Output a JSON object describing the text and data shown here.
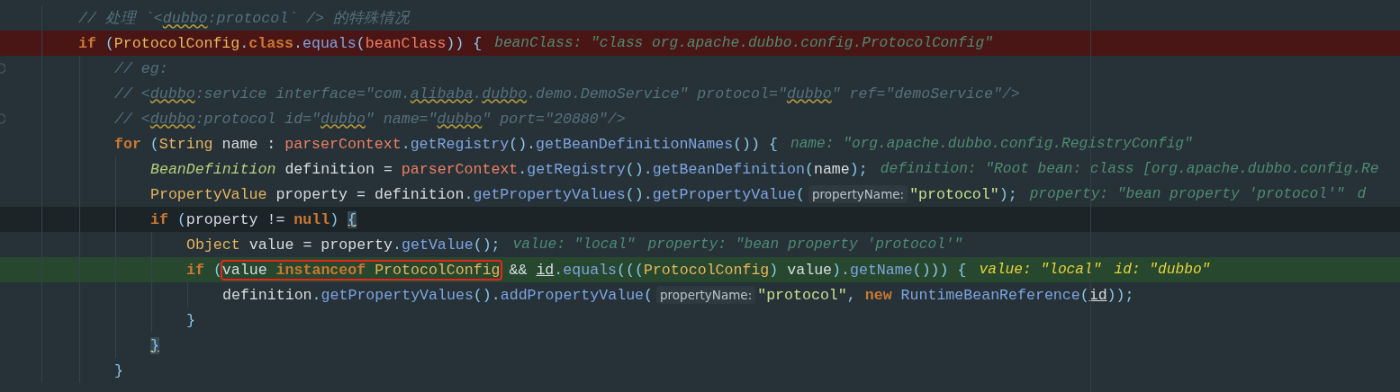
{
  "lines": [
    {
      "kind": "plain",
      "fold": false,
      "parts": [
        {
          "kind": "code",
          "tokens": [
            {
              "t": "// 处理 `<",
              "kind": "comment"
            },
            {
              "t": "dubbo",
              "kind": "typo"
            },
            {
              "t": ":protocol` /> 的特殊情况",
              "kind": "comment"
            }
          ]
        }
      ]
    },
    {
      "kind": "breakpoint",
      "fold": false,
      "parts": [
        {
          "kind": "code",
          "tokens": [
            {
              "t": "if",
              "kind": "kw"
            },
            {
              "t": " (",
              "kind": "punc"
            },
            {
              "t": "ProtocolConfig",
              "kind": "cls"
            },
            {
              "t": ".",
              "kind": "punc"
            },
            {
              "t": "class",
              "kind": "kw"
            },
            {
              "t": ".",
              "kind": "punc"
            },
            {
              "t": "equals",
              "kind": "meth"
            },
            {
              "t": "(",
              "kind": "punc"
            },
            {
              "t": "beanClass",
              "kind": "fld"
            },
            {
              "t": ")) {",
              "kind": "punc"
            }
          ]
        },
        {
          "kind": "hint",
          "text": "beanClass: \"class org.apache.dubbo.config.ProtocolConfig\""
        }
      ],
      "children": [
        {
          "kind": "plain",
          "fold": true,
          "parts": [
            {
              "kind": "code",
              "tokens": [
                {
                  "t": "// eg:",
                  "kind": "comment"
                }
              ]
            }
          ]
        },
        {
          "kind": "plain",
          "fold": false,
          "parts": [
            {
              "kind": "code",
              "tokens": [
                {
                  "t": "// <",
                  "kind": "comment"
                },
                {
                  "t": "dubbo",
                  "kind": "typo"
                },
                {
                  "t": ":service interface=\"com.",
                  "kind": "comment"
                },
                {
                  "t": "alibaba",
                  "kind": "typo"
                },
                {
                  "t": ".",
                  "kind": "comment"
                },
                {
                  "t": "dubbo",
                  "kind": "typo"
                },
                {
                  "t": ".demo.DemoService\" protocol=\"",
                  "kind": "comment"
                },
                {
                  "t": "dubbo",
                  "kind": "typo"
                },
                {
                  "t": "\" ref=\"demoService\"/>",
                  "kind": "comment"
                }
              ]
            }
          ]
        },
        {
          "kind": "plain",
          "fold": true,
          "parts": [
            {
              "kind": "code",
              "tokens": [
                {
                  "t": "// <",
                  "kind": "comment"
                },
                {
                  "t": "dubbo",
                  "kind": "typo"
                },
                {
                  "t": ":protocol id=\"",
                  "kind": "comment"
                },
                {
                  "t": "dubbo",
                  "kind": "typo"
                },
                {
                  "t": "\" name=\"",
                  "kind": "comment"
                },
                {
                  "t": "dubbo",
                  "kind": "typo"
                },
                {
                  "t": "\" port=\"20880\"/>",
                  "kind": "comment"
                }
              ]
            }
          ]
        },
        {
          "kind": "plain",
          "fold": false,
          "parts": [
            {
              "kind": "code",
              "tokens": [
                {
                  "t": "for",
                  "kind": "kw"
                },
                {
                  "t": " (",
                  "kind": "punc"
                },
                {
                  "t": "String",
                  "kind": "cls"
                },
                {
                  "t": " name : ",
                  "kind": "ident"
                },
                {
                  "t": "parserContext",
                  "kind": "fld"
                },
                {
                  "t": ".",
                  "kind": "punc"
                },
                {
                  "t": "getRegistry",
                  "kind": "meth"
                },
                {
                  "t": "().",
                  "kind": "punc"
                },
                {
                  "t": "getBeanDefinitionNames",
                  "kind": "meth"
                },
                {
                  "t": "()) {",
                  "kind": "punc"
                }
              ]
            },
            {
              "kind": "hint",
              "text": "name: \"org.apache.dubbo.config.RegistryConfig\""
            }
          ],
          "children": [
            {
              "kind": "plain",
              "fold": false,
              "parts": [
                {
                  "kind": "code",
                  "tokens": [
                    {
                      "t": "BeanDefinition",
                      "kind": "itype"
                    },
                    {
                      "t": " definition = ",
                      "kind": "ident"
                    },
                    {
                      "t": "parserContext",
                      "kind": "fld"
                    },
                    {
                      "t": ".",
                      "kind": "punc"
                    },
                    {
                      "t": "getRegistry",
                      "kind": "meth"
                    },
                    {
                      "t": "().",
                      "kind": "punc"
                    },
                    {
                      "t": "getBeanDefinition",
                      "kind": "meth"
                    },
                    {
                      "t": "(",
                      "kind": "punc"
                    },
                    {
                      "t": "name",
                      "kind": "ident"
                    },
                    {
                      "t": ");",
                      "kind": "punc"
                    }
                  ]
                },
                {
                  "kind": "hint",
                  "text": "definition: \"Root bean: class [org.apache.dubbo.config.Re"
                }
              ]
            },
            {
              "kind": "plain",
              "fold": false,
              "parts": [
                {
                  "kind": "code",
                  "tokens": [
                    {
                      "t": "PropertyValue",
                      "kind": "cls"
                    },
                    {
                      "t": " property = definition",
                      "kind": "ident"
                    },
                    {
                      "t": ".",
                      "kind": "punc"
                    },
                    {
                      "t": "getPropertyValues",
                      "kind": "meth"
                    },
                    {
                      "t": "().",
                      "kind": "punc"
                    },
                    {
                      "t": "getPropertyValue",
                      "kind": "meth"
                    },
                    {
                      "t": "(",
                      "kind": "punc"
                    }
                  ]
                },
                {
                  "kind": "chip",
                  "text": "propertyName:"
                },
                {
                  "kind": "code",
                  "tokens": [
                    {
                      "t": "\"protocol\"",
                      "kind": "str"
                    },
                    {
                      "t": ");",
                      "kind": "punc"
                    }
                  ]
                },
                {
                  "kind": "hint",
                  "text": "property: \"bean property 'protocol'\""
                },
                {
                  "kind": "hint",
                  "text": "d"
                }
              ]
            },
            {
              "kind": "caret",
              "fold": false,
              "parts": [
                {
                  "kind": "code",
                  "tokens": [
                    {
                      "t": "if",
                      "kind": "kw"
                    },
                    {
                      "t": " (",
                      "kind": "punc"
                    },
                    {
                      "t": "property != ",
                      "kind": "ident"
                    },
                    {
                      "t": "null",
                      "kind": "kw"
                    },
                    {
                      "t": ") ",
                      "kind": "punc"
                    },
                    {
                      "t": "{",
                      "kind": "brace"
                    }
                  ]
                }
              ],
              "children": [
                {
                  "kind": "plain",
                  "fold": false,
                  "parts": [
                    {
                      "kind": "code",
                      "tokens": [
                        {
                          "t": "Object",
                          "kind": "cls"
                        },
                        {
                          "t": " value = property",
                          "kind": "ident"
                        },
                        {
                          "t": ".",
                          "kind": "punc"
                        },
                        {
                          "t": "getValue",
                          "kind": "meth"
                        },
                        {
                          "t": "();",
                          "kind": "punc"
                        }
                      ]
                    },
                    {
                      "kind": "hint",
                      "text": "value: \"local\""
                    },
                    {
                      "kind": "hint",
                      "text": "property: \"bean property 'protocol'\""
                    }
                  ]
                },
                {
                  "kind": "execution",
                  "fold": false,
                  "parts": [
                    {
                      "kind": "code",
                      "tokens": [
                        {
                          "t": "if",
                          "kind": "kw"
                        },
                        {
                          "t": " (",
                          "kind": "punc"
                        }
                      ]
                    },
                    {
                      "kind": "boxed",
                      "tokens": [
                        {
                          "t": "value ",
                          "kind": "ident"
                        },
                        {
                          "t": "instanceof",
                          "kind": "kw"
                        },
                        {
                          "t": " ProtocolConfig",
                          "kind": "cls"
                        }
                      ]
                    },
                    {
                      "kind": "code",
                      "tokens": [
                        {
                          "t": " && ",
                          "kind": "ident"
                        },
                        {
                          "t": "id",
                          "kind": "param"
                        },
                        {
                          "t": ".",
                          "kind": "punc"
                        },
                        {
                          "t": "equals",
                          "kind": "meth"
                        },
                        {
                          "t": "(((",
                          "kind": "punc"
                        },
                        {
                          "t": "ProtocolConfig",
                          "kind": "cls"
                        },
                        {
                          "t": ")",
                          "kind": "punc"
                        },
                        {
                          "t": " value",
                          "kind": "ident"
                        },
                        {
                          "t": ").",
                          "kind": "punc"
                        },
                        {
                          "t": "getName",
                          "kind": "meth"
                        },
                        {
                          "t": "())) {",
                          "kind": "punc"
                        }
                      ]
                    },
                    {
                      "kind": "hint",
                      "text": "value: \"local\""
                    },
                    {
                      "kind": "hint",
                      "text": "id: \"dubbo\""
                    }
                  ],
                  "children": [
                    {
                      "kind": "plain",
                      "fold": false,
                      "parts": [
                        {
                          "kind": "code",
                          "tokens": [
                            {
                              "t": "definition",
                              "kind": "ident"
                            },
                            {
                              "t": ".",
                              "kind": "punc"
                            },
                            {
                              "t": "getPropertyValues",
                              "kind": "meth"
                            },
                            {
                              "t": "().",
                              "kind": "punc"
                            },
                            {
                              "t": "addPropertyValue",
                              "kind": "meth"
                            },
                            {
                              "t": "(",
                              "kind": "punc"
                            }
                          ]
                        },
                        {
                          "kind": "chip",
                          "text": "propertyName:"
                        },
                        {
                          "kind": "code",
                          "tokens": [
                            {
                              "t": "\"protocol\"",
                              "kind": "str"
                            },
                            {
                              "t": ", ",
                              "kind": "punc"
                            },
                            {
                              "t": "new",
                              "kind": "kw"
                            },
                            {
                              "t": " RuntimeBeanReference",
                              "kind": "meth"
                            },
                            {
                              "t": "(",
                              "kind": "punc"
                            },
                            {
                              "t": "id",
                              "kind": "param"
                            },
                            {
                              "t": "));",
                              "kind": "punc"
                            }
                          ]
                        }
                      ]
                    }
                  ]
                },
                {
                  "kind": "plain",
                  "fold": false,
                  "parts": [
                    {
                      "kind": "code",
                      "tokens": [
                        {
                          "t": "}",
                          "kind": "punc"
                        }
                      ]
                    }
                  ]
                }
              ]
            },
            {
              "kind": "plain",
              "fold": false,
              "parts": [
                {
                  "kind": "code",
                  "tokens": [
                    {
                      "t": "}",
                      "kind": "brace"
                    }
                  ]
                }
              ]
            }
          ]
        },
        {
          "kind": "plain",
          "fold": false,
          "parts": [
            {
              "kind": "code",
              "tokens": [
                {
                  "t": "}",
                  "kind": "punc"
                }
              ]
            }
          ]
        }
      ]
    }
  ]
}
